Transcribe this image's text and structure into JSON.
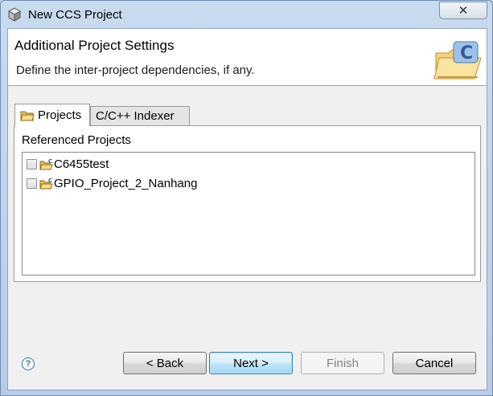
{
  "window": {
    "title": "New CCS Project",
    "close_label": "✕"
  },
  "header": {
    "title": "Additional Project Settings",
    "description": "Define the inter-project dependencies, if any."
  },
  "tabs": [
    {
      "label": "Projects",
      "active": true
    },
    {
      "label": "C/C++ Indexer",
      "active": false
    }
  ],
  "panel": {
    "label": "Referenced Projects",
    "projects": [
      {
        "name": "C6455test",
        "checked": false
      },
      {
        "name": "GPIO_Project_2_Nanhang",
        "checked": false
      }
    ]
  },
  "buttons": {
    "help": "?",
    "back": "< Back",
    "next": "Next >",
    "finish": "Finish",
    "cancel": "Cancel"
  },
  "colors": {
    "accent": "#3c7fb1",
    "help_blue": "#3b6fb5"
  }
}
